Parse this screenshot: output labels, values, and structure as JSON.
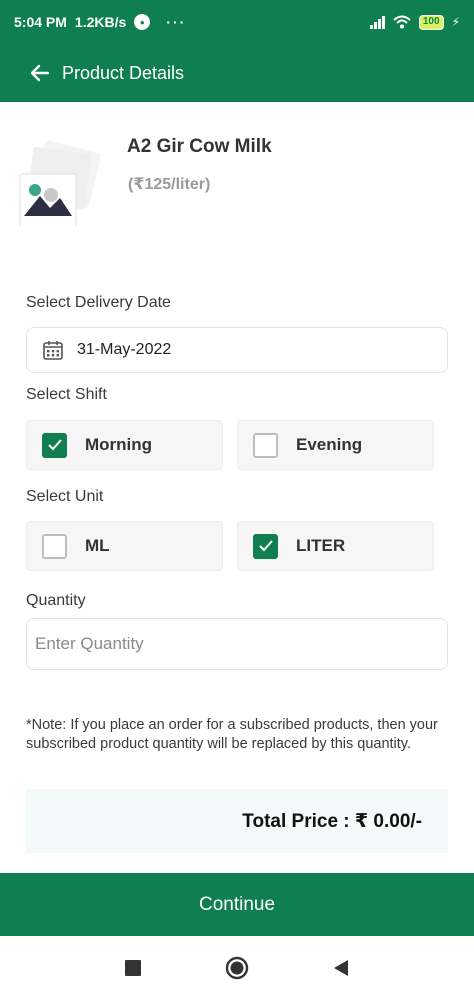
{
  "status_bar": {
    "time": "5:04 PM",
    "speed": "1.2KB/s",
    "more": "···",
    "battery": "100"
  },
  "app_bar": {
    "title": "Product Details"
  },
  "product": {
    "name": "A2 Gir Cow Milk",
    "price": "(₹125/liter)"
  },
  "delivery": {
    "label": "Select Delivery Date",
    "date": "31-May-2022"
  },
  "shift": {
    "label": "Select Shift",
    "options": [
      {
        "label": "Morning",
        "checked": true
      },
      {
        "label": "Evening",
        "checked": false
      }
    ]
  },
  "unit": {
    "label": "Select Unit",
    "options": [
      {
        "label": "ML",
        "checked": false
      },
      {
        "label": "LITER",
        "checked": true
      }
    ]
  },
  "quantity": {
    "label": "Quantity",
    "placeholder": "Enter Quantity",
    "value": ""
  },
  "note": "*Note: If you place an order for a subscribed products, then your subscribed product quantity will be replaced by this quantity.",
  "total": "Total Price : ₹ 0.00/-",
  "continue_label": "Continue",
  "colors": {
    "primary": "#0f7f4f",
    "total_bg": "#f4f9f9"
  }
}
